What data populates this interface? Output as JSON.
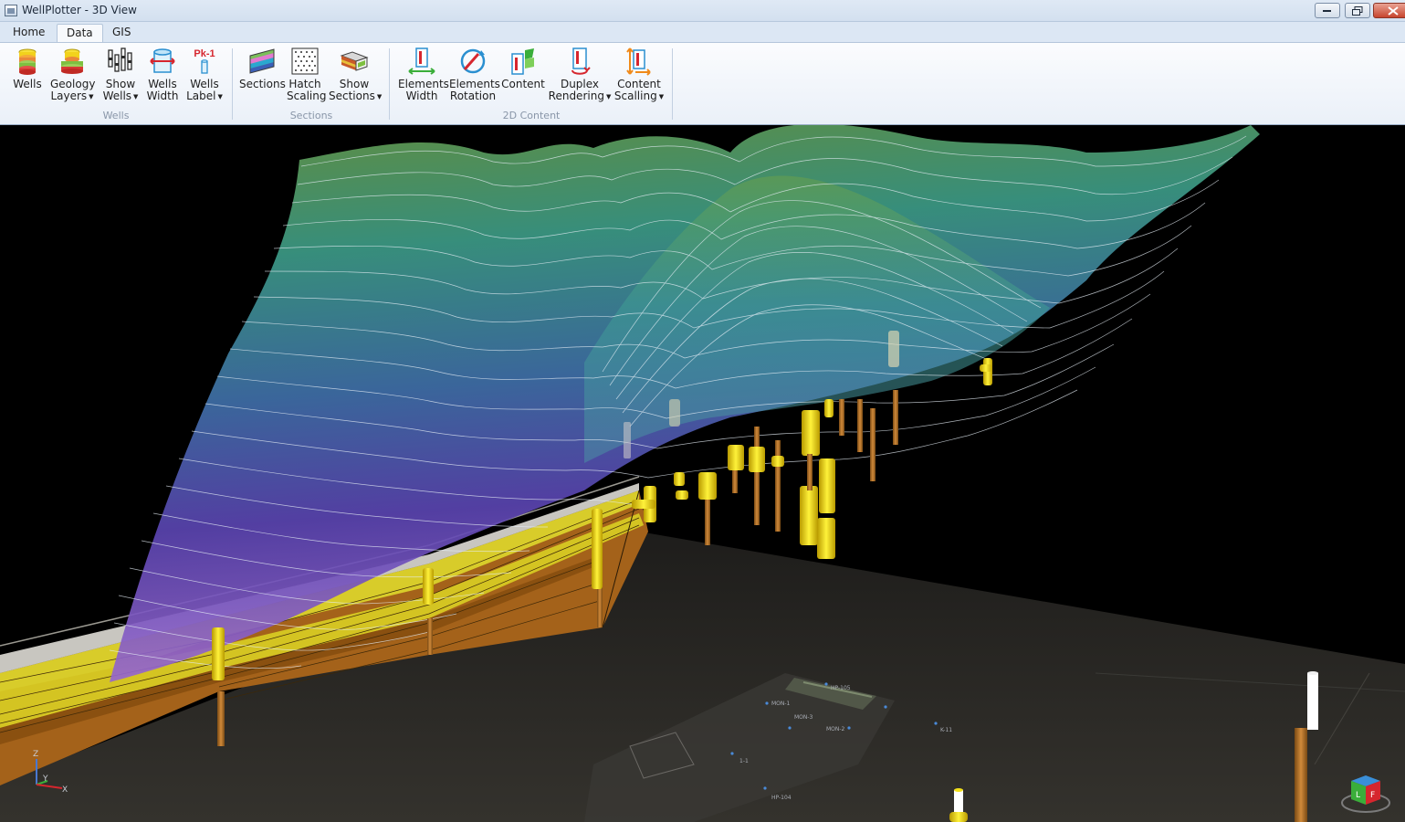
{
  "window": {
    "title": "WellPlotter - 3D View"
  },
  "tabs": [
    {
      "label": "Home"
    },
    {
      "label": "Data"
    },
    {
      "label": "GIS"
    }
  ],
  "ribbon": {
    "groups": [
      {
        "title": "Wells"
      },
      {
        "title": "Sections"
      },
      {
        "title": "2D Content"
      }
    ],
    "wells": {
      "wells": {
        "line1": "Wells"
      },
      "geology_layers": {
        "line1": "Geology",
        "line2": "Layers"
      },
      "show_wells": {
        "line1": "Show",
        "line2": "Wells"
      },
      "wells_width": {
        "line1": "Wells",
        "line2": "Width"
      },
      "wells_label": {
        "line1": "Wells",
        "line2": "Label",
        "icon_text": "Pk-1"
      }
    },
    "sections": {
      "sections": {
        "line1": "Sections"
      },
      "hatch_scaling": {
        "line1": "Hatch",
        "line2": "Scaling"
      },
      "show_sections": {
        "line1": "Show",
        "line2": "Sections"
      }
    },
    "content2d": {
      "elements_width": {
        "line1": "Elements",
        "line2": "Width"
      },
      "elements_rotation": {
        "line1": "Elements",
        "line2": "Rotation"
      },
      "content": {
        "line1": "Content"
      },
      "duplex_rendering": {
        "line1": "Duplex",
        "line2": "Rendering"
      },
      "content_scaling": {
        "line1": "Content",
        "line2": "Scalling"
      }
    }
  },
  "viewport": {
    "axis": {
      "z": "Z",
      "y": "Y",
      "x": "X"
    },
    "map_labels": [
      "MON-1",
      "MON-2",
      "MON-3",
      "HP-105",
      "HP-104",
      "1-1",
      "K-11"
    ],
    "colors": {
      "surface_top": "#5f8f48",
      "surface_mid": "#3f8f8e",
      "surface_low": "#5a47a8",
      "surface_violet": "#8a5bc4",
      "layer_yellow": "#d8cc2a",
      "layer_brown": "#b06a1a",
      "well_yellow": "#f2e01a",
      "ground": "#2c2a27"
    }
  }
}
